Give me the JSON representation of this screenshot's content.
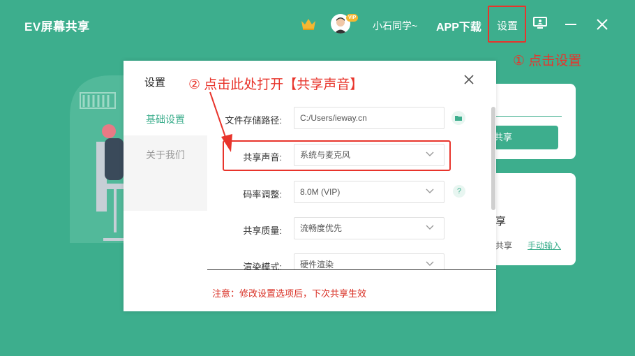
{
  "app": {
    "title": "EV屏幕共享"
  },
  "header": {
    "vip_badge": "VIP",
    "username": "小石同学~",
    "app_download": "APP下载",
    "settings": "设置"
  },
  "annotations": {
    "step1": "① 点击设置",
    "step2": "② 点击此处打开【共享声音】"
  },
  "background": {
    "card1_button": "共享",
    "card2_title": "享",
    "card2_text": "共享",
    "card2_link": "手动输入"
  },
  "dialog": {
    "title": "设置",
    "sidebar": [
      {
        "label": "基础设置",
        "active": true
      },
      {
        "label": "关于我们",
        "active": false
      }
    ],
    "rows": {
      "path_label": "文件存储路径:",
      "path_value": "C:/Users/ieway.cn",
      "sound_label": "共享声音:",
      "sound_value": "系统与麦克风",
      "bitrate_label": "码率调整:",
      "bitrate_value": "8.0M (VIP)",
      "quality_label": "共享质量:",
      "quality_value": "流畅度优先",
      "render_label": "渲染模式:",
      "render_value": "硬件渲染"
    },
    "help": "?",
    "notice": "注意：修改设置选项后，下次共享生效"
  },
  "colors": {
    "brand": "#3dae8d",
    "annotation": "#e8342b",
    "notice": "#d93025"
  }
}
